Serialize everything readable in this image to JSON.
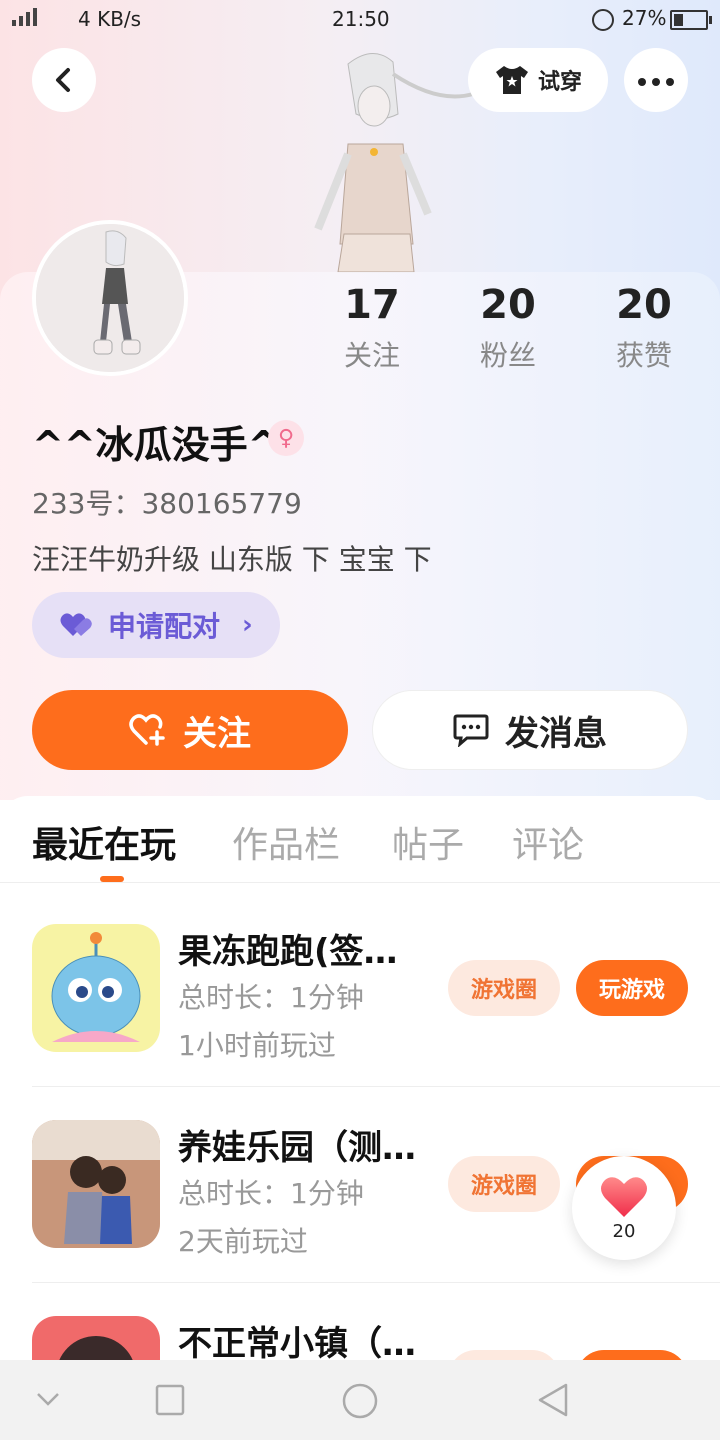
{
  "status_bar": {
    "network_speed": "4 KB/s",
    "time": "21:50",
    "battery": "27%"
  },
  "header": {
    "try_on_label": "试穿"
  },
  "stats": [
    {
      "value": "17",
      "label": "关注"
    },
    {
      "value": "20",
      "label": "粉丝"
    },
    {
      "value": "20",
      "label": "获赞"
    }
  ],
  "profile": {
    "nickname": "^^冰瓜没手^",
    "gender_symbol": "♀",
    "uid_line": "233号：380165779",
    "bio": "汪汪牛奶升级 山东版 下 宝宝 下",
    "pair_label": "申请配对"
  },
  "actions": {
    "follow_label": "关注",
    "message_label": "发消息"
  },
  "tabs": [
    {
      "label": "最近在玩",
      "active": true
    },
    {
      "label": "作品栏",
      "active": false
    },
    {
      "label": "帖子",
      "active": false
    },
    {
      "label": "评论",
      "active": false
    }
  ],
  "games": [
    {
      "name": "果冻跑跑(签…",
      "duration": "总时长：1分钟",
      "last_played": "1小时前玩过",
      "circle_label": "游戏圈",
      "play_label": "玩游戏"
    },
    {
      "name": "养娃乐园（测…",
      "duration": "总时长：1分钟",
      "last_played": "2天前玩过",
      "circle_label": "游戏圈",
      "play_label": "玩游戏"
    },
    {
      "name": "不正常小镇（…",
      "duration": "",
      "last_played": "",
      "circle_label": "",
      "play_label": ""
    }
  ],
  "floating_like": {
    "count": "20"
  },
  "colors": {
    "accent": "#fe6d1c",
    "pair_purple": "#6b5bd6",
    "circle_tag_bg": "#fde9df"
  }
}
